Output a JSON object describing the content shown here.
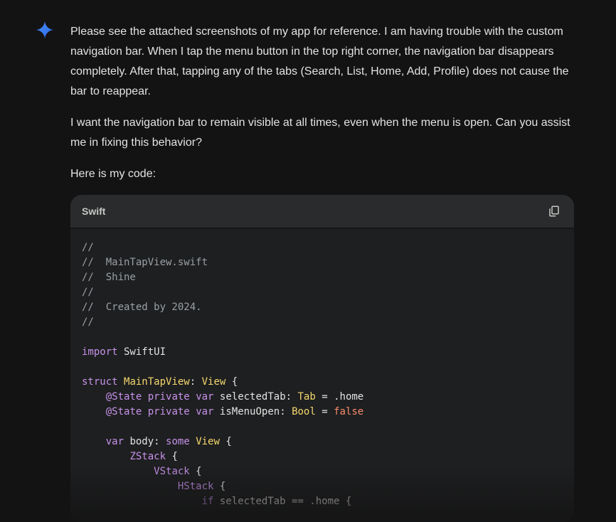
{
  "message": {
    "paragraph_1": "Please see the attached screenshots of my app for reference. I am having trouble with the custom navigation bar. When I tap the menu button in the top right corner, the navigation bar disappears completely. After that, tapping any of the tabs (Search, List, Home, Add, Profile) does not cause the bar to reappear.",
    "paragraph_2": "I want the navigation bar to remain visible at all times, even when the menu is open. Can you assist me in fixing this behavior?",
    "paragraph_3": "Here is my code:"
  },
  "code_block": {
    "language": "Swift",
    "copy_icon": "copy-icon",
    "lines": [
      "//",
      "//  MainTapView.swift",
      "//  Shine",
      "//",
      "//  Created by 2024.",
      "//",
      "",
      "import SwiftUI",
      "",
      "struct MainTapView: View {",
      "    @State private var selectedTab: Tab = .home",
      "    @State private var isMenuOpen: Bool = false",
      "",
      "    var body: some View {",
      "        ZStack {",
      "            VStack {",
      "                HStack {",
      "                    if selectedTab == .home {"
    ]
  },
  "icons": {
    "assistant": "gemini-sparkle-icon"
  },
  "colors": {
    "background": "#131314",
    "code_bg": "#1e1f20",
    "code_header": "#2a2b2c",
    "sparkle": "#4a8af4"
  }
}
